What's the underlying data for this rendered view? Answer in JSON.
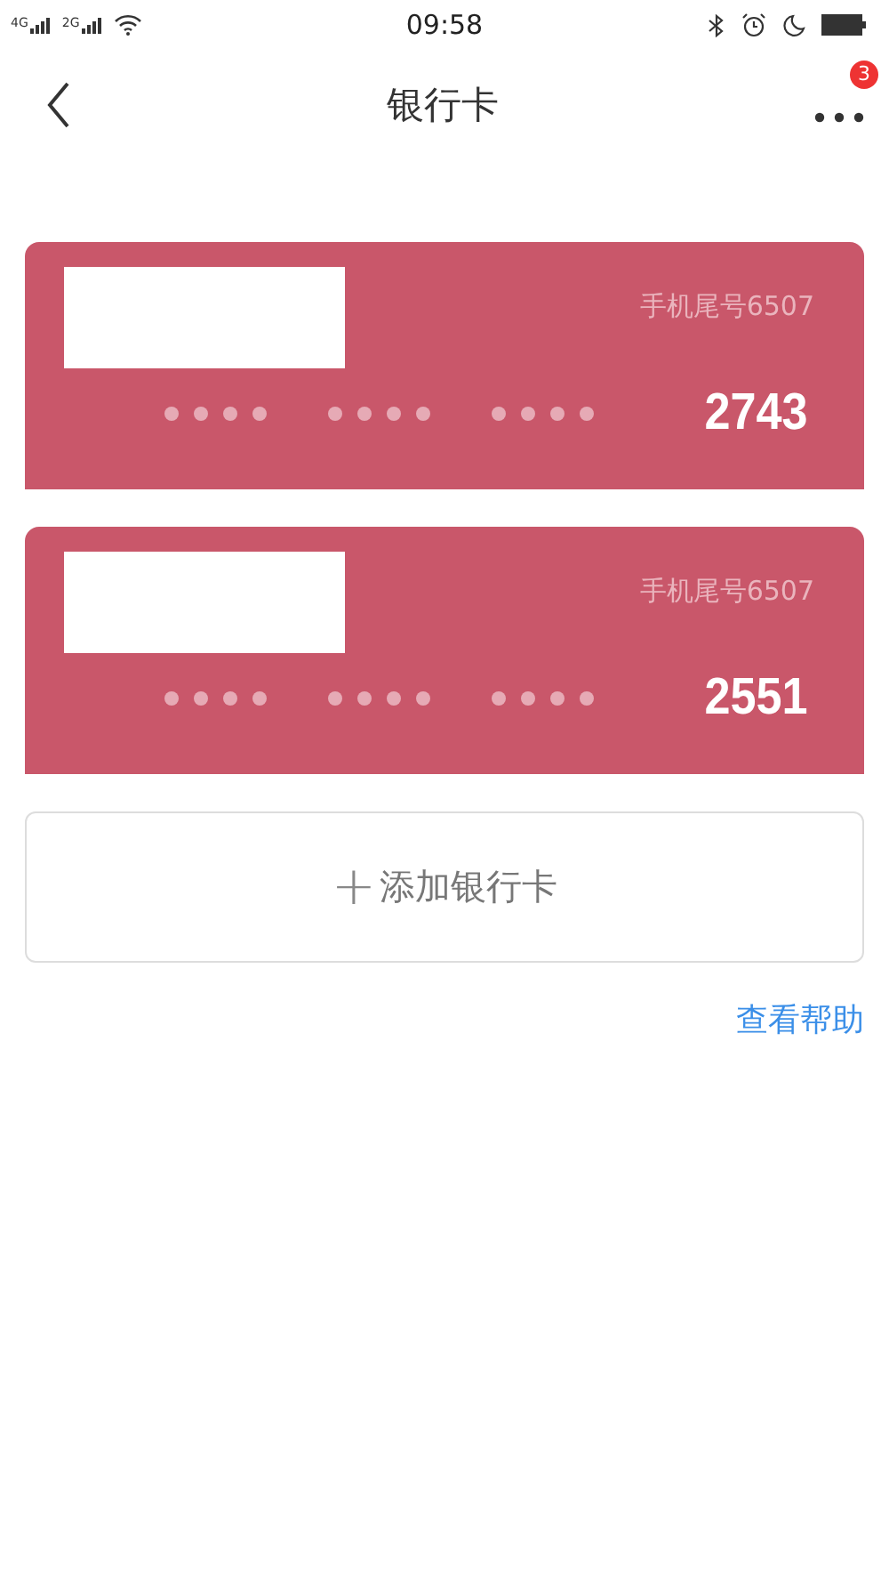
{
  "status_bar": {
    "network_1": "4G",
    "network_2": "2G",
    "time": "09:58"
  },
  "nav": {
    "title": "银行卡",
    "more_badge": "3"
  },
  "cards": [
    {
      "phone_hint": "手机尾号6507",
      "last_digits": "2743"
    },
    {
      "phone_hint": "手机尾号6507",
      "last_digits": "2551"
    }
  ],
  "add_button": {
    "icon": "+",
    "label": "添加银行卡"
  },
  "help_link": "查看帮助"
}
